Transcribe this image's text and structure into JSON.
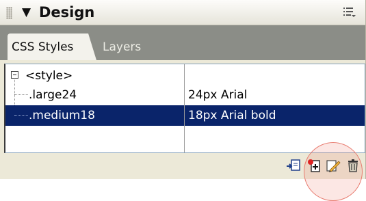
{
  "panel": {
    "title": "Design",
    "collapse_glyph": "▼"
  },
  "tabs": [
    {
      "label": "CSS Styles",
      "active": true
    },
    {
      "label": "Layers",
      "active": false
    }
  ],
  "rules": [
    {
      "name": "<style>",
      "value": "",
      "expanded": true,
      "selected": false
    },
    {
      "name": ".large24",
      "value": "24px Arial",
      "selected": false
    },
    {
      "name": ".medium18",
      "value": "18px Arial bold",
      "selected": true
    }
  ],
  "toolbar": {
    "icons": [
      "attach-style-sheet-icon",
      "new-css-rule-icon",
      "edit-style-icon",
      "delete-css-rule-icon"
    ]
  },
  "colors": {
    "selection": "#0a246a",
    "highlight": "#f07869"
  }
}
